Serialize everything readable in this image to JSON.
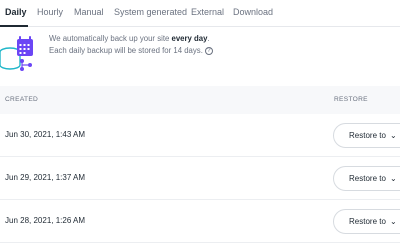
{
  "tabs": [
    "Daily",
    "Hourly",
    "Manual",
    "System generated",
    "External",
    "Download"
  ],
  "active_tab": "Daily",
  "info": {
    "line1_prefix": "We automatically back up your site ",
    "line1_bold": "every day",
    "line1_suffix": ".",
    "line2": "Each daily backup will be stored for 14 days.",
    "help_icon": "?"
  },
  "table": {
    "columns": [
      "CREATED",
      "RESTORE"
    ],
    "rows": [
      {
        "created": "Jun 30, 2021, 1:43 AM",
        "action": "Restore to"
      },
      {
        "created": "Jun 29, 2021, 1:37 AM",
        "action": "Restore to"
      },
      {
        "created": "Jun 28, 2021, 1:26 AM",
        "action": "Restore to"
      }
    ]
  },
  "colors": {
    "accent": "#1f2933",
    "illustration_purple": "#6b46f5",
    "illustration_teal": "#1fb6c9"
  }
}
